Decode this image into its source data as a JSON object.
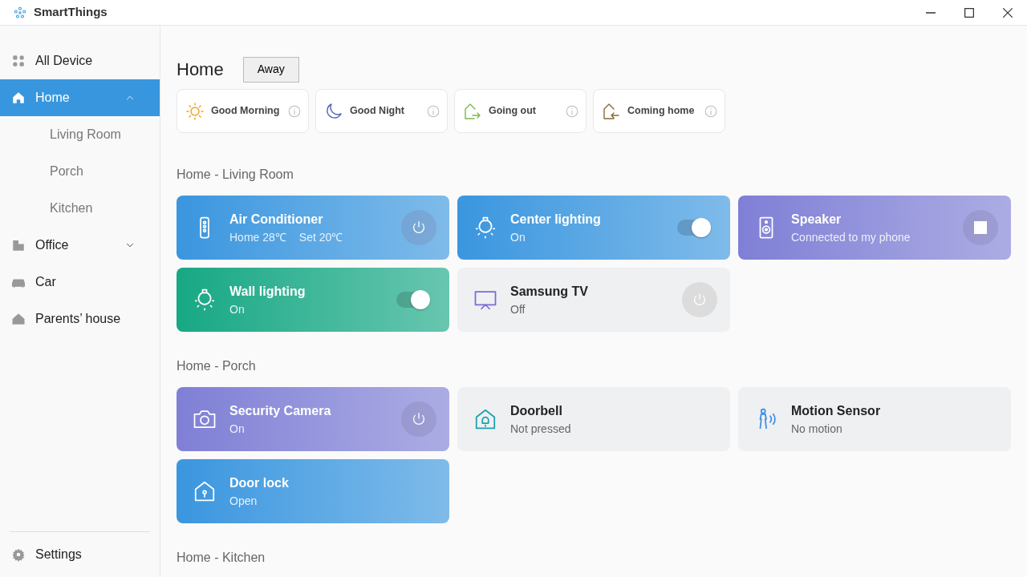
{
  "window": {
    "title": "SmartThings"
  },
  "sidebar": {
    "items": [
      {
        "kind": "grid",
        "label": "All Device",
        "selected": false
      },
      {
        "kind": "home",
        "label": "Home",
        "selected": true,
        "expanded": true,
        "children": [
          {
            "label": "Living Room"
          },
          {
            "label": "Porch"
          },
          {
            "label": "Kitchen"
          }
        ]
      },
      {
        "kind": "office",
        "label": "Office",
        "selected": false,
        "expanded": false
      },
      {
        "kind": "car",
        "label": "Car",
        "selected": false
      },
      {
        "kind": "house",
        "label": "Parents’ house",
        "selected": false
      }
    ],
    "settings": {
      "label": "Settings"
    }
  },
  "header": {
    "title": "Home",
    "mode_button": "Away"
  },
  "scenes": [
    {
      "kind": "morning",
      "label": "Good Morning"
    },
    {
      "kind": "night",
      "label": "Good Night"
    },
    {
      "kind": "out",
      "label": "Going out"
    },
    {
      "kind": "in",
      "label": "Coming home"
    }
  ],
  "sections": [
    {
      "title": "Home - Living Room",
      "devices": [
        {
          "kind": "ac",
          "color": "#3a96df",
          "name": "Air Conditioner",
          "status": [
            "Home 28℃",
            "Set 20℃"
          ],
          "control": {
            "kind": "power"
          }
        },
        {
          "kind": "bulb",
          "color": "#3a96df",
          "name": "Center lighting",
          "status": [
            "On"
          ],
          "control": {
            "kind": "toggle",
            "on": true
          }
        },
        {
          "kind": "speaker",
          "color": "#7f7fd6",
          "name": "Speaker",
          "status": [
            "Connected to my phone"
          ],
          "control": {
            "kind": "stop"
          }
        },
        {
          "kind": "bulb",
          "color": "#17a884",
          "name": "Wall lighting",
          "status": [
            "On"
          ],
          "control": {
            "kind": "toggle",
            "on": true
          }
        },
        {
          "kind": "tv",
          "color": "#eff0f2",
          "name": "Samsung TV",
          "status": [
            "Off"
          ],
          "control": {
            "kind": "power"
          }
        }
      ]
    },
    {
      "title": "Home - Porch",
      "devices": [
        {
          "kind": "camera",
          "color": "#7f7fd6",
          "name": "Security Camera",
          "status": [
            "On"
          ],
          "control": {
            "kind": "power"
          }
        },
        {
          "kind": "doorbell",
          "color": "#eff0f2",
          "name": "Doorbell",
          "status": [
            "Not pressed"
          ]
        },
        {
          "kind": "motion",
          "color": "#eff0f2",
          "name": "Motion Sensor",
          "status": [
            "No motion"
          ]
        },
        {
          "kind": "lock",
          "color": "#3a96df",
          "name": "Door lock",
          "status": [
            "Open"
          ]
        }
      ]
    },
    {
      "title": "Home - Kitchen"
    }
  ]
}
